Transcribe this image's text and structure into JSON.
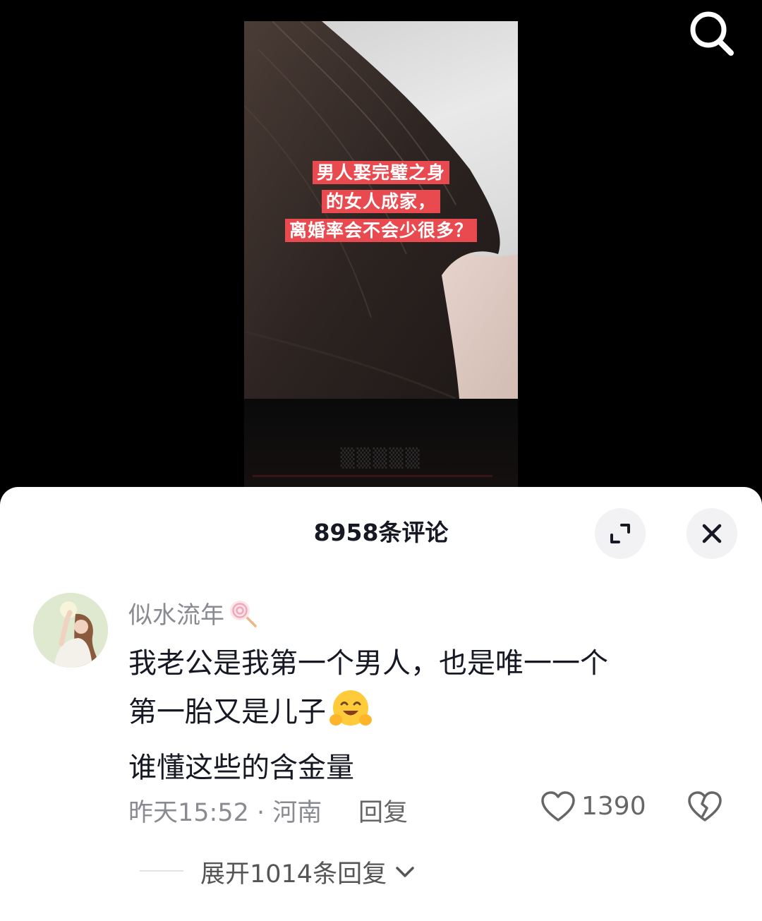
{
  "video": {
    "caption_lines": [
      "男人娶完璧之身",
      "的女人成家，",
      "离婚率会不会少很多？"
    ],
    "bottom_text": "▒▒▒▒▒"
  },
  "icons": {
    "search": "search-icon",
    "expand": "expand-icon",
    "close": "close-icon",
    "like": "heart-icon",
    "dislike": "broken-heart-icon",
    "chevron": "chevron-down-icon"
  },
  "comments_panel": {
    "title": "8958条评论"
  },
  "comment": {
    "username": "似水流年",
    "lines": [
      "我老公是我第一个男人，也是唯一一个",
      "第一胎又是儿子",
      "谁懂这些的含金量"
    ],
    "meta": "昨天15:52 · 河南",
    "reply_label": "回复",
    "like_count": "1390",
    "expand_replies_label": "展开1014条回复"
  },
  "colors": {
    "caption_bg": "#e84a4f",
    "text_primary": "#161823",
    "text_secondary": "#8a8b91"
  }
}
